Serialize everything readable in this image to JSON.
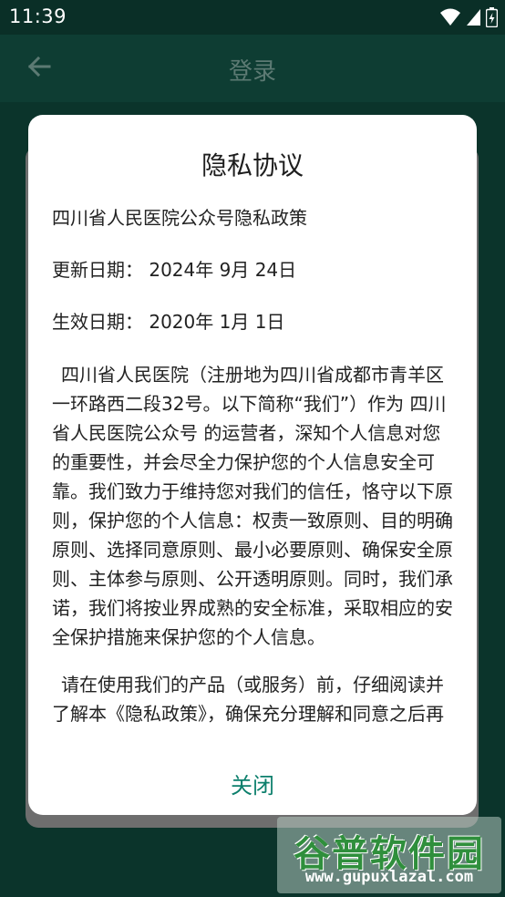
{
  "status_bar": {
    "time": "11:39",
    "icons": [
      "wifi-icon",
      "signal-icon",
      "battery-icon"
    ]
  },
  "app_bar": {
    "title": "登录",
    "back_icon": "arrow-back-icon"
  },
  "dialog": {
    "title": "隐私协议",
    "policy_name": "四川省人民医院公众号隐私政策",
    "updated_date": "更新日期： 2024年 9月 24日",
    "effective_date": "生效日期： 2020年 1月 1日",
    "paragraph_1": "四川省人民医院（注册地为四川省成都市青羊区一环路西二段32号。以下简称“我们”）作为 四川省人民医院公众号 的运营者，深知个人信息对您的重要性，并会尽全力保护您的个人信息安全可靠。我们致力于维持您对我们的信任，恪守以下原则，保护您的个人信息：权责一致原则、目的明确原则、选择同意原则、最小必要原则、确保安全原则、主体参与原则、公开透明原则。同时，我们承诺，我们将按业界成熟的安全标准，采取相应的安全保护措施来保护您的个人信息。",
    "paragraph_2": "请在使用我们的产品（或服务）前，仔细阅读并了解本《隐私政策》，确保充分理解和同意之后再开始使用。",
    "close_label": "关闭"
  },
  "watermark": {
    "title": "谷普软件园",
    "url": "www.gupuxlazal.com"
  },
  "colors": {
    "background": "#0e3d33",
    "status_bar": "#0a2f27",
    "accent": "#0c7f6c",
    "dialog": "#ffffff"
  }
}
